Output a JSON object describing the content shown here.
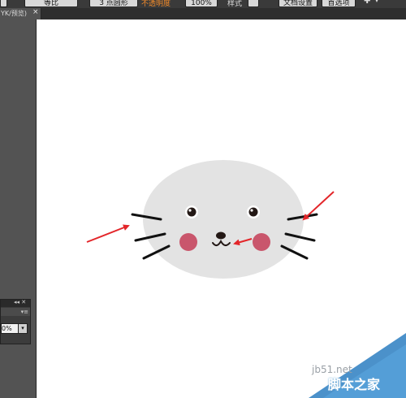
{
  "toolbar": {
    "field1_value": "等比",
    "field2_value": "3 点圆形",
    "orange_label": "不透明度",
    "field3_value": "100%",
    "style_label": "样式",
    "doc_setup_label": "文档设置",
    "preferences_label": "首选项"
  },
  "document_tab": {
    "title": "YK/预览)",
    "close_glyph": "×"
  },
  "side_panel": {
    "header_controls": "◂◂ ✕",
    "menu_glyph": "▾≡",
    "value": "0%",
    "dropdown_glyph": "▾"
  },
  "artwork": {
    "subject": "seal-face",
    "face_color": "#e3e3e3",
    "eye_color": "#231815",
    "eye_ring_color": "#ffffff",
    "cheek_color": "#c9566c",
    "whisker_color": "#111111",
    "arrow_color": "#e3262a"
  },
  "watermark": {
    "site": "jb51.net",
    "brand": "脚本之家",
    "accent": "#2b7ec1"
  }
}
